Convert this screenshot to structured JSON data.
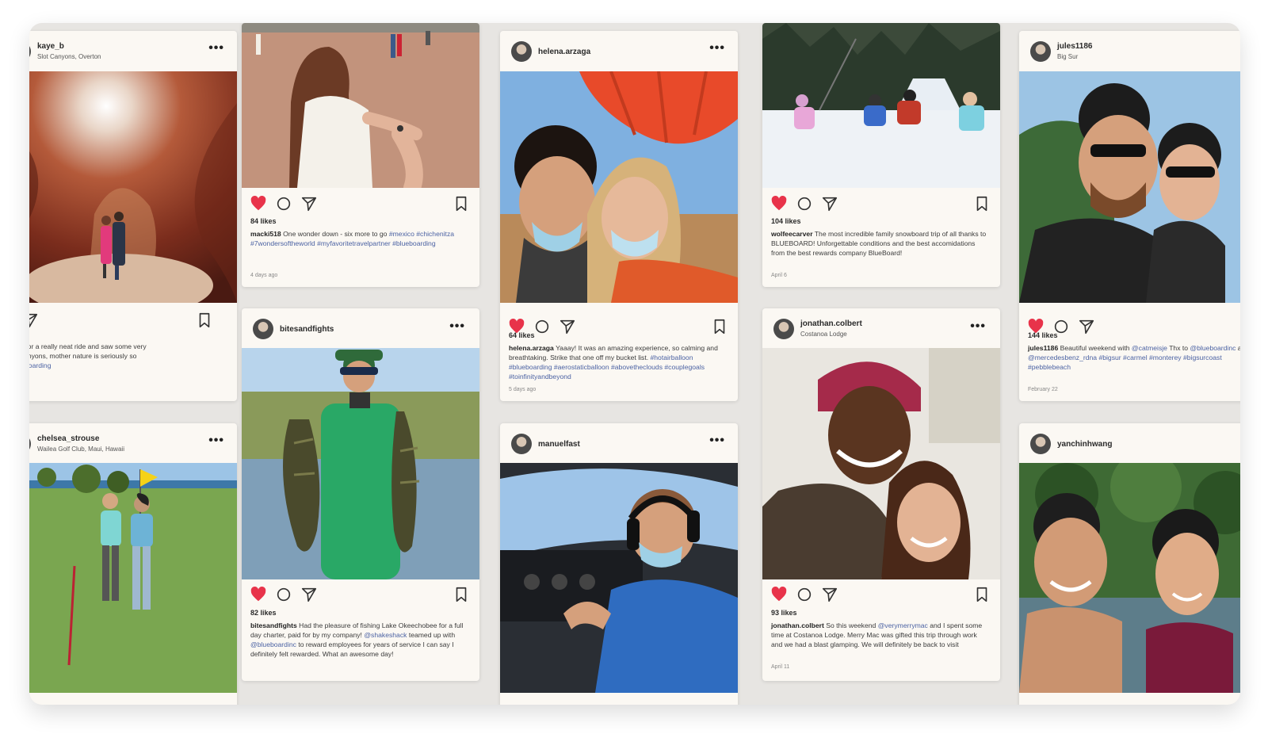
{
  "posts": [
    {
      "user": "kaye_b",
      "location": "Slot Canyons, Overton",
      "caption": "Went for a really neat ride and saw some very",
      "caption2": "slot canyons, mother nature is seriously so",
      "tags": "#blueboarding"
    },
    {
      "user": "chelsea_strouse",
      "location": "Wailea Golf Club, Maui, Hawaii"
    },
    {
      "likes": "84 likes",
      "user": "macki518",
      "caption": "One wonder down - six more to go",
      "tags": "#mexico #chichenitza #7wondersoftheworld #myfavoritetravelpartner #blueboarding",
      "time": "4 days ago"
    },
    {
      "user": "bitesandfights",
      "likes": "82 likes",
      "caption": "Had the pleasure of fishing Lake Okeechobee for a full day charter, paid for by my company!",
      "m1": "@shakeshack",
      "cap2": "teamed up with",
      "m2": "@blueboardinc",
      "cap3": "to reward employees for years of service I can say I definitely felt rewarded. What an awesome day!"
    },
    {
      "user": "helena.arzaga",
      "likes": "64 likes",
      "caption": "Yaaay! It was an amazing experience, so calming and breathtaking. Strike that one off my bucket list.",
      "tags": "#hotairballoon #blueboarding #aerostaticballoon #abovetheclouds #couplegoals #toinfinityandbeyond",
      "time": "5 days ago"
    },
    {
      "user": "manuelfast"
    },
    {
      "likes": "104 likes",
      "user": "wolfeecarver",
      "caption": "The most incredible family snowboard trip of all thanks to BLUEBOARD! Unforgettable conditions and the best accomidations from the best rewards company BlueBoard!",
      "time": "April 6"
    },
    {
      "user": "jonathan.colbert",
      "location": "Costanoa Lodge",
      "likes": "93 likes",
      "caption": "So this weekend",
      "m1": "@verymerrymac",
      "cap2": "and I spent some time at Costanoa Lodge. Merry Mac was gifted this trip through work and we had a blast glamping. We will definitely be back to visit",
      "time": "April 11"
    },
    {
      "user": "jules1186",
      "location": "Big Sur",
      "likes": "144 likes",
      "caption": "Beautiful weekend with",
      "m1": "@catmeisje",
      "cap2": "Thx to",
      "m2": "@blueboardinc",
      "cap3": "and",
      "m3": "@mercedesbenz_rdna",
      "tags": "#bigsur #carmel #monterey #bigsurcoast #pebblebeach",
      "time": "February 22"
    },
    {
      "user": "yanchinhwang"
    }
  ],
  "colors": {
    "heart": "#e8334a",
    "card": "#fbf8f3",
    "link": "#4b62a3"
  },
  "icons": [
    "heart-icon",
    "comment-icon",
    "share-icon",
    "bookmark-icon",
    "more-icon"
  ]
}
